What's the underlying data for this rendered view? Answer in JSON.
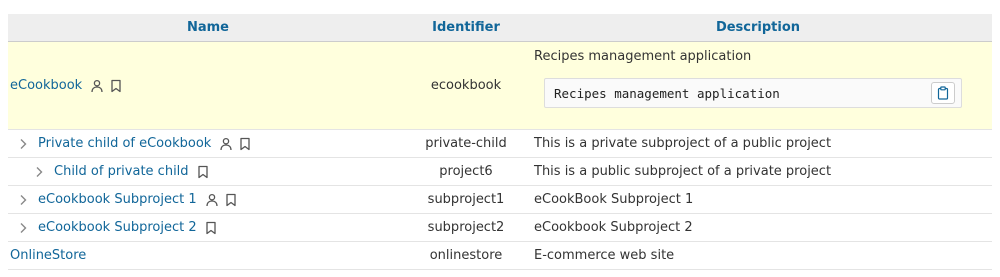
{
  "table": {
    "headers": {
      "name": "Name",
      "identifier": "Identifier",
      "description": "Description"
    },
    "rows": [
      {
        "name": "eCookbook",
        "identifier": "ecookbook",
        "description": "Recipes management application",
        "description_code": "Recipes management application",
        "level": 0,
        "expandable": false,
        "member": true,
        "bookmarked": true,
        "highlighted": true
      },
      {
        "name": "Private child of eCookbook",
        "identifier": "private-child",
        "description": "This is a private subproject of a public project",
        "level": 1,
        "expandable": true,
        "member": true,
        "bookmarked": true
      },
      {
        "name": "Child of private child",
        "identifier": "project6",
        "description": "This is a public subproject of a private project",
        "level": 2,
        "expandable": true,
        "member": false,
        "bookmarked": true
      },
      {
        "name": "eCookbook Subproject 1",
        "identifier": "subproject1",
        "description": "eCookBook Subproject 1",
        "level": 1,
        "expandable": true,
        "member": true,
        "bookmarked": true
      },
      {
        "name": "eCookbook Subproject 2",
        "identifier": "subproject2",
        "description": "eCookbook Subproject 2",
        "level": 1,
        "expandable": true,
        "member": false,
        "bookmarked": true
      },
      {
        "name": "OnlineStore",
        "identifier": "onlinestore",
        "description": "E-commerce web site",
        "level": 0,
        "expandable": false,
        "member": false,
        "bookmarked": false
      }
    ]
  },
  "icons": {
    "member": "user-icon",
    "bookmark": "bookmark-icon",
    "expand": "chevron-right-icon",
    "copy": "clipboard-icon"
  },
  "colors": {
    "link": "#116699",
    "header_bg": "#eeeeee",
    "highlight_bg": "#ffffdd"
  }
}
